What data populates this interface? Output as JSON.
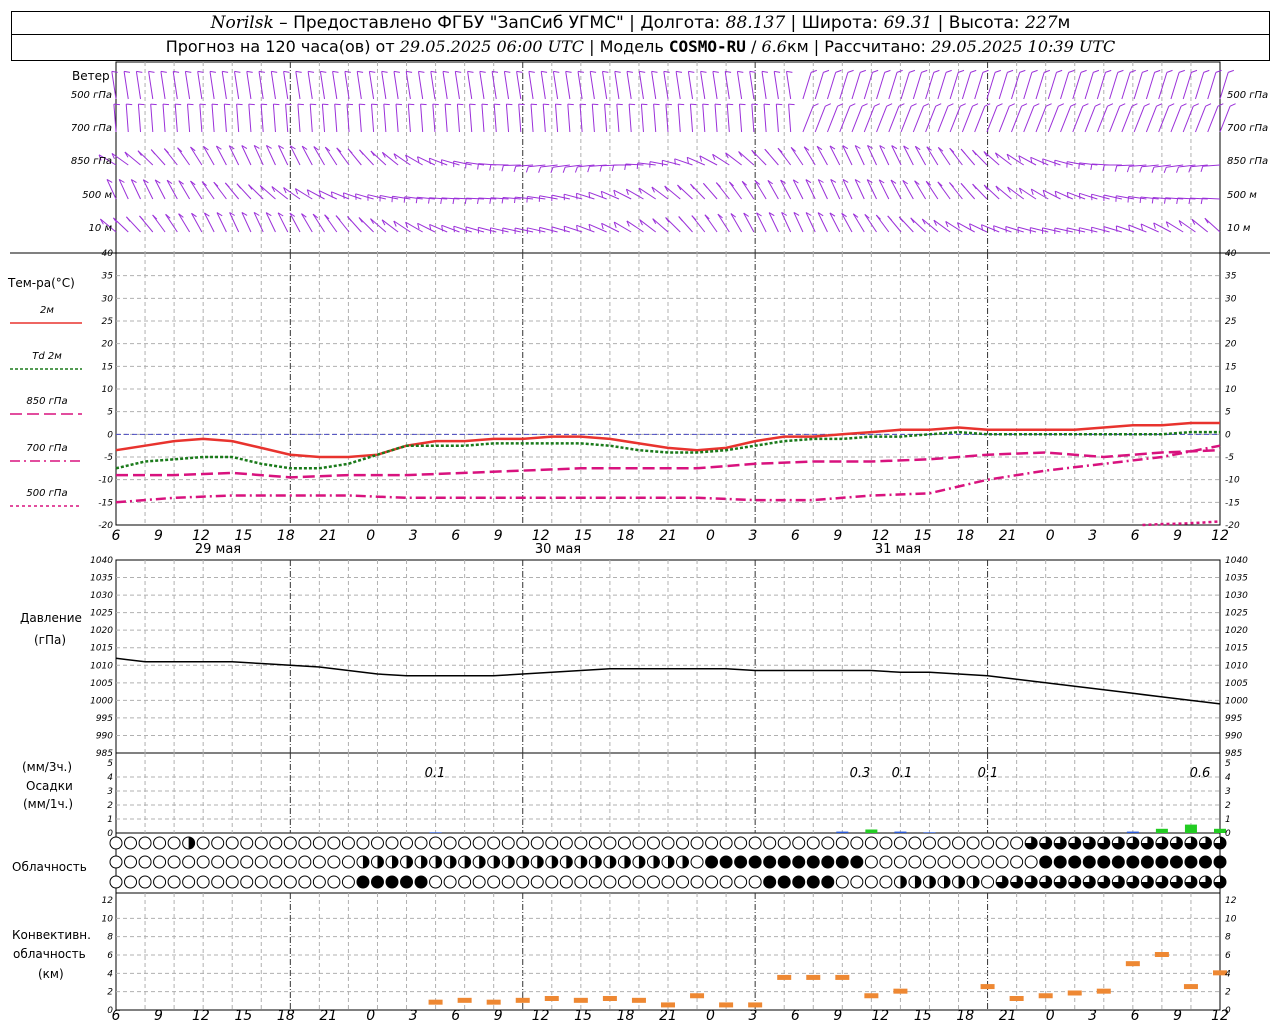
{
  "header": {
    "place": "Norilsk",
    "dash": " – ",
    "provider": "Предоставлено ФГБУ \"ЗапСиб УГМС\"",
    "sep": " | ",
    "lon_label": "Долгота: ",
    "lon": "88.137",
    "lat_label": "Широта: ",
    "lat": "69.31",
    "alt_label": "Высота: ",
    "alt": "227",
    "alt_unit": "м",
    "forecast_label": "Прогноз на 120 часа(ов) от ",
    "forecast_from": "29.05.2025 06:00 UTC",
    "model_sep": "  | Модель ",
    "model": "COSMO-RU",
    "model_res_sep": " / ",
    "model_res": "6.6",
    "model_res_unit": "км",
    "calc_label": " | Рассчитано: ",
    "calc_time": "29.05.2025 10:39 UTC"
  },
  "axis": {
    "hour_ticks": [
      "6",
      "9",
      "12",
      "15",
      "18",
      "21",
      "0",
      "3",
      "6",
      "9",
      "12",
      "15",
      "18",
      "21",
      "0",
      "3",
      "6",
      "9",
      "12",
      "15",
      "18",
      "21",
      "0",
      "3",
      "6",
      "9",
      "12"
    ],
    "day_labels": [
      "29 мая",
      "30 мая",
      "31 мая"
    ]
  },
  "panels": {
    "wind": {
      "title": "Ветер",
      "levels": [
        "500 гПа",
        "700 гПа",
        "850 гПа",
        "500 м",
        "10   м"
      ],
      "color": "#9b30d9"
    },
    "temp": {
      "title": "Тем-ра(°C)",
      "legend": [
        {
          "label": "2м",
          "color": "#e8332e",
          "dash": ""
        },
        {
          "label": "Td  2м",
          "color": "#1a7a1a",
          "dash": "3,2"
        },
        {
          "label": "850 гПа",
          "color": "#d8127e",
          "dash": "12,5"
        },
        {
          "label": "700 гПа",
          "color": "#d8127e",
          "dash": "10,4,2,4"
        },
        {
          "label": "500 гПа",
          "color": "#d8127e",
          "dash": "3,3"
        }
      ],
      "yticks": [
        "40",
        "35",
        "30",
        "25",
        "20",
        "15",
        "10",
        "5",
        "0",
        "-5",
        "-10",
        "-15",
        "-20"
      ]
    },
    "pressure": {
      "title": "Давление",
      "unit": "(гПа)",
      "yticks": [
        "1040",
        "1035",
        "1030",
        "1025",
        "1020",
        "1015",
        "1010",
        "1005",
        "1000",
        "995",
        "990",
        "985"
      ]
    },
    "precip": {
      "unit3h": "(мм/3ч.)",
      "title": "Осадки",
      "unit1h": "(мм/1ч.)",
      "yticks": [
        "5",
        "4",
        "3",
        "2",
        "1",
        "0"
      ],
      "totals": [
        {
          "text": "0.1"
        },
        {
          "text": "0.3"
        },
        {
          "text": "0.1"
        },
        {
          "text": "0.1"
        },
        {
          "text": "0.6"
        }
      ]
    },
    "cloud": {
      "title": "Облачность"
    },
    "convective": {
      "title1": "Конвективн.",
      "title2": "облачность",
      "unit": "(км)",
      "yticks": [
        "12",
        "10",
        "8",
        "6",
        "4",
        "2",
        "0"
      ]
    }
  },
  "chart_data": [
    {
      "type": "line",
      "title": "Тем-ра(°C)",
      "x_unit": "hours since 29.05.2025 06:00 UTC",
      "ylim": [
        -20,
        40
      ],
      "grid": true,
      "series": [
        {
          "name": "2м",
          "x": [
            0,
            3,
            6,
            9,
            12,
            15,
            18,
            21,
            24,
            27,
            30,
            33,
            36,
            39,
            42,
            45,
            48,
            51,
            54,
            57,
            60,
            63,
            66,
            69,
            72,
            75,
            78,
            81,
            84,
            87,
            90,
            93,
            96,
            99,
            102,
            105,
            108,
            111,
            114
          ],
          "values": [
            -3.5,
            -2.5,
            -1.5,
            -1,
            -1.5,
            -3,
            -4.5,
            -5,
            -5,
            -4.5,
            -2.5,
            -1.5,
            -1.5,
            -1,
            -1,
            -0.5,
            -0.5,
            -1,
            -2,
            -3,
            -3.5,
            -3,
            -1.5,
            -0.5,
            -0.5,
            0,
            0.5,
            1,
            1,
            1.5,
            1,
            1,
            1,
            1,
            1.5,
            2,
            2,
            2.5,
            2.5
          ]
        },
        {
          "name": "Td  2м",
          "x": [
            0,
            3,
            6,
            9,
            12,
            15,
            18,
            21,
            24,
            27,
            30,
            33,
            36,
            39,
            42,
            45,
            48,
            51,
            54,
            57,
            60,
            63,
            66,
            69,
            72,
            75,
            78,
            81,
            84,
            87,
            90,
            93,
            96,
            99,
            102,
            105,
            108,
            111,
            114
          ],
          "values": [
            -7.5,
            -6,
            -5.5,
            -5,
            -5,
            -6.5,
            -7.5,
            -7.5,
            -6.5,
            -4.5,
            -2.5,
            -2.5,
            -2.5,
            -2,
            -2,
            -2,
            -2,
            -2.5,
            -3.5,
            -4,
            -4,
            -3.5,
            -2.5,
            -1.5,
            -1,
            -1,
            -0.5,
            -0.5,
            0,
            0.5,
            0,
            0,
            0,
            0,
            0,
            0,
            0,
            0.5,
            0.5
          ]
        },
        {
          "name": "850 гПа",
          "x": [
            0,
            6,
            12,
            18,
            24,
            30,
            36,
            42,
            48,
            54,
            60,
            66,
            72,
            78,
            84,
            90,
            96,
            102,
            108,
            114
          ],
          "values": [
            -9,
            -9,
            -8.5,
            -9.5,
            -9,
            -9,
            -8.5,
            -8,
            -7.5,
            -7.5,
            -7.5,
            -6.5,
            -6,
            -6,
            -5.5,
            -4.5,
            -4,
            -5,
            -4,
            -3.5
          ]
        },
        {
          "name": "700 гПа",
          "x": [
            0,
            6,
            12,
            18,
            24,
            30,
            36,
            42,
            48,
            54,
            60,
            66,
            72,
            78,
            84,
            90,
            96,
            102,
            108,
            114
          ],
          "values": [
            -15,
            -14,
            -13.5,
            -13.5,
            -13.5,
            -14,
            -14,
            -14,
            -14,
            -14,
            -14,
            -14.5,
            -14.5,
            -13.5,
            -13,
            -10,
            -8,
            -6.5,
            -5,
            -2.5
          ]
        },
        {
          "name": "500 гПа",
          "x": [
            106,
            108,
            110,
            112,
            114
          ],
          "values": [
            -20,
            -19.8,
            -19.7,
            -19.5,
            -19.2
          ]
        }
      ]
    },
    {
      "type": "line",
      "title": "Давление",
      "x_unit": "hours since 29.05.2025 06:00 UTC",
      "ylim": [
        985,
        1040
      ],
      "grid": true,
      "series": [
        {
          "name": "",
          "x": [
            0,
            3,
            6,
            9,
            12,
            15,
            18,
            21,
            24,
            27,
            30,
            33,
            36,
            39,
            42,
            45,
            48,
            51,
            54,
            57,
            60,
            63,
            66,
            69,
            72,
            75,
            78,
            81,
            84,
            87,
            90,
            93,
            96,
            99,
            102,
            105,
            108,
            111,
            114
          ],
          "values": [
            1012,
            1011,
            1011,
            1011,
            1011,
            1010.5,
            1010,
            1009.5,
            1008.5,
            1007.5,
            1007,
            1007,
            1007,
            1007,
            1007.5,
            1008,
            1008.5,
            1009,
            1009,
            1009,
            1009,
            1009,
            1008.5,
            1008.5,
            1008.5,
            1008.5,
            1008.5,
            1008,
            1008,
            1007.5,
            1007,
            1006,
            1005,
            1004,
            1003,
            1002,
            1001,
            1000,
            999
          ]
        }
      ]
    },
    {
      "type": "bar",
      "title": "Осадки",
      "x_unit": "hours since 29.05.2025 06:00 UTC",
      "ylim": [
        0,
        5
      ],
      "series": [
        {
          "name": "",
          "x": [
            33,
            75,
            78,
            81,
            84,
            105,
            108,
            111,
            114
          ],
          "values": [
            0.05,
            0.1,
            0.25,
            0.1,
            0.05,
            0.1,
            0.3,
            0.6,
            0.3
          ]
        }
      ]
    },
    {
      "type": "bar",
      "title": "Конвективн. облачность",
      "x_unit": "hours since 29.05.2025 06:00 UTC",
      "ylim": [
        0,
        12
      ],
      "series": [
        {
          "name": "",
          "x": [
            33,
            36,
            39,
            42,
            45,
            48,
            51,
            54,
            57,
            60,
            63,
            66,
            69,
            72,
            75,
            78,
            81,
            84,
            87,
            90,
            93,
            96,
            99,
            102,
            105,
            108,
            111,
            114
          ],
          "values": [
            0.8,
            1,
            0.8,
            1,
            1.2,
            1,
            1.2,
            1,
            0.5,
            1.5,
            0.5,
            0.5,
            3.5,
            3.5,
            3.5,
            1.5,
            2,
            0,
            0,
            2.5,
            1.2,
            1.5,
            1.8,
            2,
            5,
            6,
            2.5,
            4
          ]
        }
      ]
    }
  ]
}
